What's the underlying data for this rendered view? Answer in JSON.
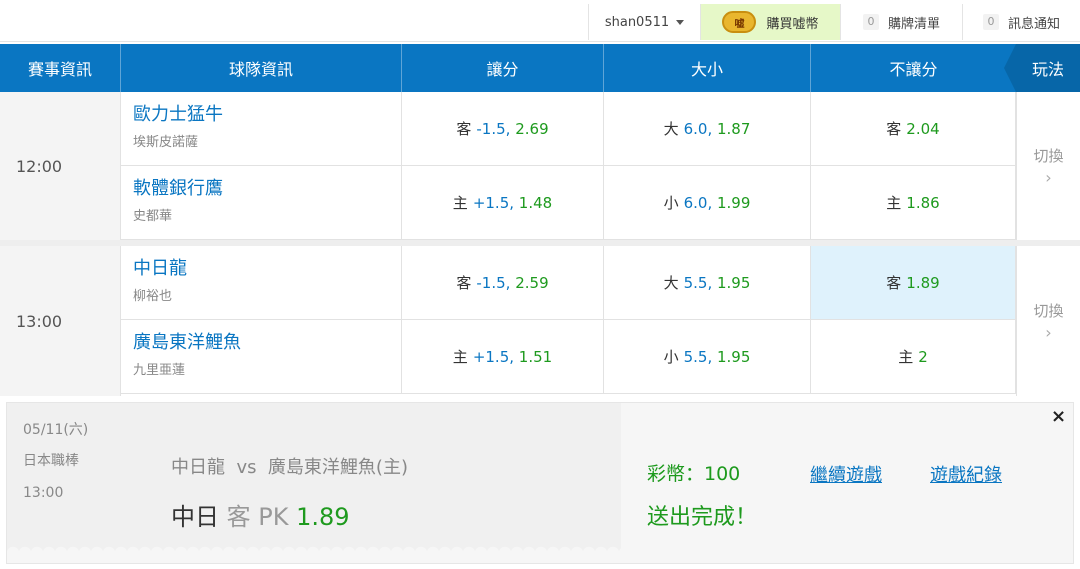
{
  "topbar": {
    "username": "shan0511",
    "buy_coin_icon": "coin-icon",
    "buy_coin_icon_text": "嘘",
    "buy_label": "購買嘘幣",
    "cart_count": "0",
    "cart_label": "購牌清單",
    "msg_count": "0",
    "msg_label": "訊息通知"
  },
  "header": {
    "col_event": "賽事資訊",
    "col_team": "球隊資訊",
    "col_handicap": "讓分",
    "col_overunder": "大小",
    "col_moneyline": "不讓分",
    "col_play": "玩法"
  },
  "matches": [
    {
      "time": "12:00",
      "switch_label": "切換",
      "teams": [
        {
          "name": "歐力士猛牛",
          "pitcher": "埃斯皮諾薩",
          "handicap": {
            "side": "客",
            "line": "-1.5,",
            "odds": "2.69"
          },
          "overunder": {
            "side": "大",
            "line": "6.0,",
            "odds": "1.87"
          },
          "moneyline": {
            "side": "客",
            "odds": "2.04"
          }
        },
        {
          "name": "軟體銀行鷹",
          "pitcher": "史都華",
          "handicap": {
            "side": "主",
            "line": "+1.5,",
            "odds": "1.48"
          },
          "overunder": {
            "side": "小",
            "line": "6.0,",
            "odds": "1.99"
          },
          "moneyline": {
            "side": "主",
            "odds": "1.86"
          }
        }
      ]
    },
    {
      "time": "13:00",
      "switch_label": "切換",
      "teams": [
        {
          "name": "中日龍",
          "pitcher": "柳裕也",
          "handicap": {
            "side": "客",
            "line": "-1.5,",
            "odds": "2.59"
          },
          "overunder": {
            "side": "大",
            "line": "5.5,",
            "odds": "1.95"
          },
          "moneyline": {
            "side": "客",
            "odds": "1.89"
          }
        },
        {
          "name": "廣島東洋鯉魚",
          "pitcher": "九里亜蓮",
          "handicap": {
            "side": "主",
            "line": "+1.5,",
            "odds": "1.51"
          },
          "overunder": {
            "side": "小",
            "line": "5.5,",
            "odds": "1.95"
          },
          "moneyline": {
            "side": "主",
            "odds": "2"
          }
        }
      ]
    }
  ],
  "confirmation": {
    "date": "05/11(六)",
    "league": "日本職棒",
    "time": "13:00",
    "matchup": "中日龍  vs  廣島東洋鯉魚(主)",
    "bet_team": "中日",
    "bet_side": "客 PK",
    "bet_odds": "1.89",
    "coins": "彩幣：100",
    "status": "送出完成！",
    "continue_label": "繼續遊戲",
    "history_label": "遊戲紀錄",
    "close_label": "×"
  },
  "colors": {
    "brand_blue": "#0a76c2",
    "odds_green": "#1e9a1e",
    "selected_bg": "#dff2fc"
  }
}
